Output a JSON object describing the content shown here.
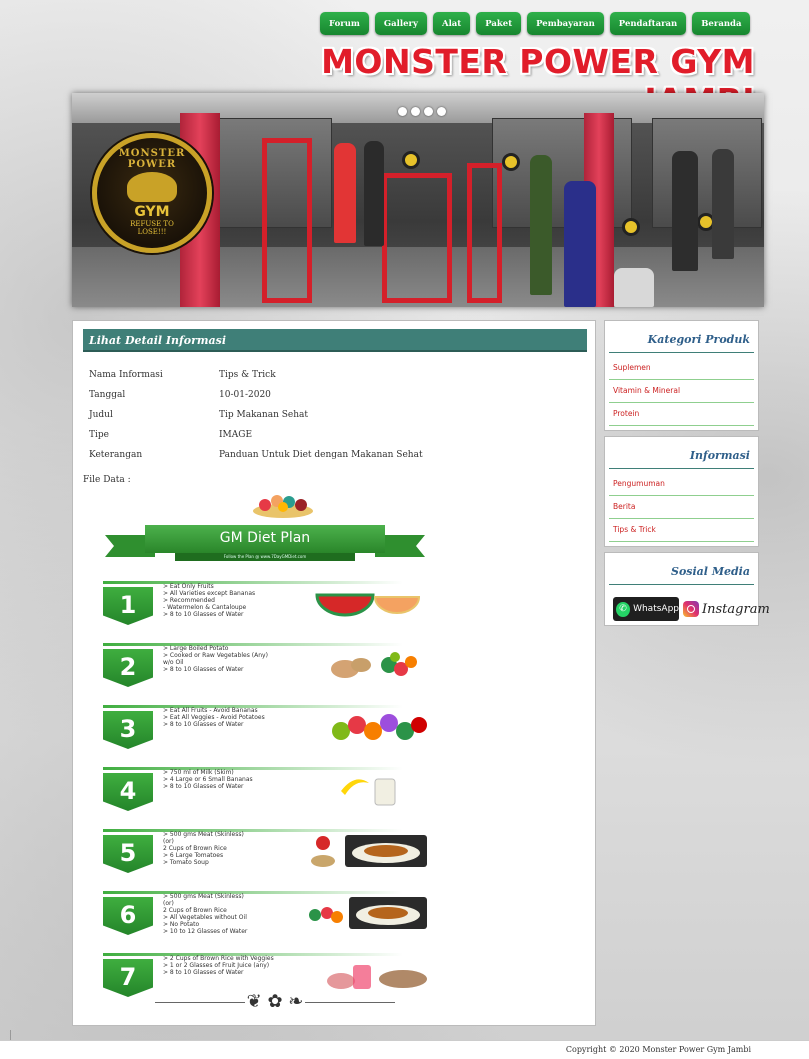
{
  "nav": {
    "items": [
      "Forum",
      "Gallery",
      "Alat",
      "Paket",
      "Pembayaran",
      "Pendaftaran",
      "Beranda"
    ]
  },
  "site_title": "MONSTER POWER GYM JAMBI",
  "banner": {
    "logo_top": "MONSTER POWER",
    "logo_gym": "GYM",
    "logo_sub1": "REFUSE TO",
    "logo_sub2": "LOSE!!!"
  },
  "main": {
    "header": "Lihat Detail Informasi",
    "rows": [
      {
        "label": "Nama Informasi",
        "value": "Tips & Trick"
      },
      {
        "label": "Tanggal",
        "value": "10-01-2020"
      },
      {
        "label": "Judul",
        "value": "Tip Makanan Sehat"
      },
      {
        "label": "Tipe",
        "value": "IMAGE"
      },
      {
        "label": "Keterangan",
        "value": "Panduan Untuk Diet dengan Makanan Sehat"
      }
    ],
    "file_label": "File Data :"
  },
  "diet_plan": {
    "title": "GM Diet Plan",
    "subtitle": "Follow the Plan @ www.7DayGMDiet.com",
    "steps": [
      {
        "num": "1",
        "lines": [
          "> Eat Only Fruits",
          "> All Varieties except Bananas",
          "> Recommended",
          "     - Watermelon & Cantaloupe",
          "> 8 to 10 Glasses of Water"
        ]
      },
      {
        "num": "2",
        "lines": [
          "> Large Boiled Potato",
          "> Cooked or Raw Vegetables (Any)",
          "    w/o Oil",
          "> 8 to 10 Glasses of Water"
        ]
      },
      {
        "num": "3",
        "lines": [
          "> Eat All Fruits - Avoid Bananas",
          "> Eat All Veggies - Avoid Potatoes",
          "> 8 to 10 Glasses of Water"
        ]
      },
      {
        "num": "4",
        "lines": [
          "> 750 ml of Milk (Skim)",
          "> 4 Large or 6 Small Bananas",
          "> 8 to 10 Glasses of Water"
        ]
      },
      {
        "num": "5",
        "lines": [
          "> 500 gms Meat (Skinless)",
          "          (or)",
          "   2 Cups of Brown Rice",
          "> 6 Large Tomatoes",
          "> Tomato Soup"
        ]
      },
      {
        "num": "6",
        "lines": [
          "> 500 gms Meat (Skinless)",
          "          (or)",
          "   2 Cups of Brown Rice",
          "> All Vegetables without Oil",
          "> No Potato",
          "> 10 to 12 Glasses of Water"
        ]
      },
      {
        "num": "7",
        "lines": [
          "> 2 Cups of Brown Rice with Veggies",
          "> 1 or 2 Glasses of Fruit Juice (any)",
          "> 8 to 10 Glasses of Water"
        ]
      }
    ]
  },
  "sidebar": {
    "kategori": {
      "title": "Kategori Produk",
      "items": [
        "Suplemen",
        "Vitamin & Mineral",
        "Protein"
      ]
    },
    "informasi": {
      "title": "Informasi",
      "items": [
        "Pengumuman",
        "Berita",
        "Tips & Trick"
      ]
    },
    "sosial": {
      "title": "Sosial Media",
      "whatsapp": "WhatsApp",
      "instagram": "Instagram"
    }
  },
  "footer": {
    "copyright": "Copyright © 2020 Monster Power Gym Jambi"
  },
  "colors": {
    "nav_green": "#1f9a3a",
    "title_red": "#e11d2a",
    "header_teal": "#3f7f78",
    "link_red": "#cc2222",
    "sidebar_title_blue": "#2f5f8a"
  }
}
